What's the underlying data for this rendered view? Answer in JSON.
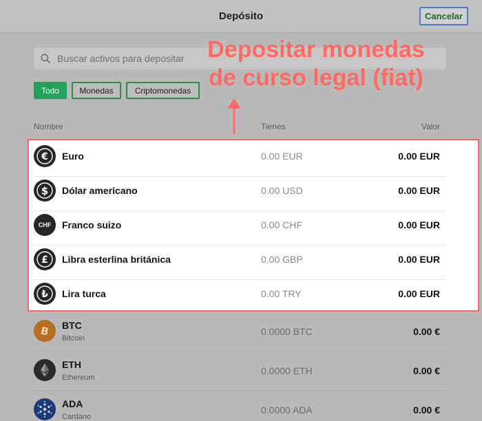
{
  "header": {
    "title": "Depósito",
    "cancel_label": "Cancelar"
  },
  "search": {
    "placeholder": "Buscar activos para depositar"
  },
  "filters": [
    {
      "label": "Todo",
      "active": true
    },
    {
      "label": "Monedas",
      "active": false
    },
    {
      "label": "Criptomonedas",
      "active": false
    }
  ],
  "columns": {
    "name": "Nombre",
    "holdings": "Tienes",
    "value": "Valor"
  },
  "annotation": {
    "line1": "Depositar monedas",
    "line2": "de curso legal (fiat)"
  },
  "fiat_assets": [
    {
      "name": "Euro",
      "holdings": "0.00 EUR",
      "value": "0.00 EUR",
      "icon": "euro-icon"
    },
    {
      "name": "Dólar americano",
      "holdings": "0.00 USD",
      "value": "0.00 EUR",
      "icon": "dollar-icon"
    },
    {
      "name": "Franco suizo",
      "holdings": "0.00 CHF",
      "value": "0.00 EUR",
      "icon": "chf-icon",
      "icon_text": "CHF"
    },
    {
      "name": "Libra esterlina británica",
      "holdings": "0.00 GBP",
      "value": "0.00 EUR",
      "icon": "pound-icon"
    },
    {
      "name": "Lira turca",
      "holdings": "0.00 TRY",
      "value": "0.00 EUR",
      "icon": "lira-icon"
    }
  ],
  "crypto_assets": [
    {
      "symbol": "BTC",
      "name": "Bitcoin",
      "holdings": "0.0000 BTC",
      "value": "0.00 €",
      "icon": "bitcoin-icon",
      "color": "#b86f20"
    },
    {
      "symbol": "ETH",
      "name": "Ethereum",
      "holdings": "0.0000 ETH",
      "value": "0.00 €",
      "icon": "ethereum-icon",
      "color": "#2a2a2a"
    },
    {
      "symbol": "ADA",
      "name": "Cardano",
      "holdings": "0.0000 ADA",
      "value": "0.00 €",
      "icon": "cardano-icon",
      "color": "#1c3a78"
    }
  ],
  "colors": {
    "accent_green": "#22a05a",
    "annotation_red": "#ff6b62",
    "cancel_border": "#4a7bd0"
  }
}
